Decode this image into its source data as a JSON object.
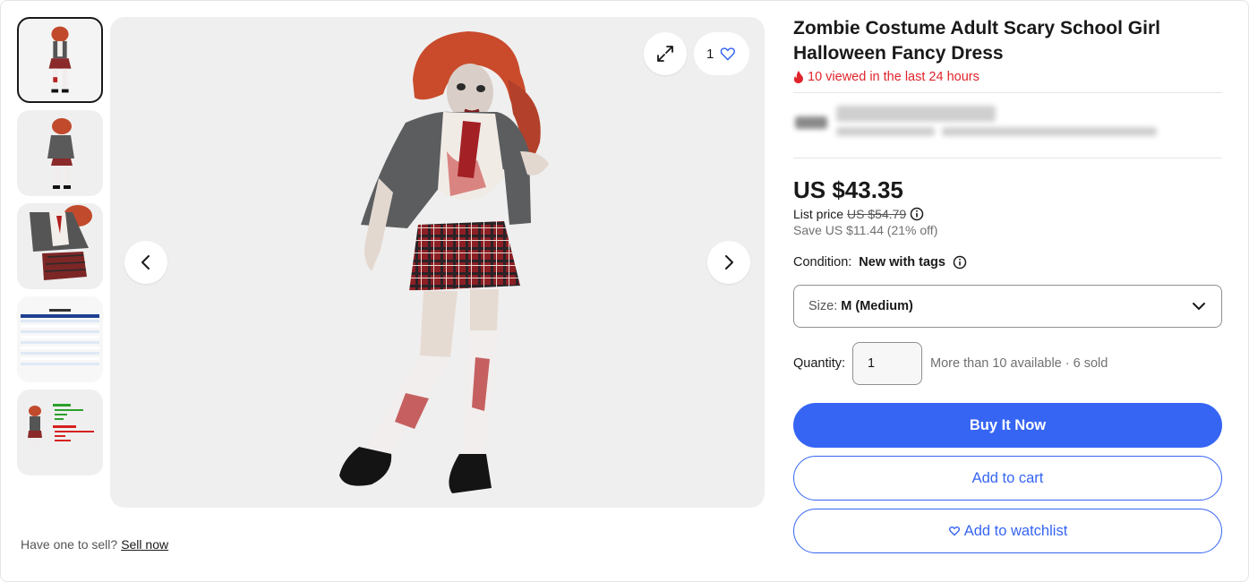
{
  "listing": {
    "title": "Zombie Costume Adult Scary School Girl Halloween Fancy Dress",
    "viewed_text": "10 viewed in the last 24 hours",
    "price": "US $43.35",
    "list_price_label": "List price",
    "list_price_value": "US $54.79",
    "savings": "Save US $11.44 (21% off)",
    "condition_label": "Condition:",
    "condition_value": "New with tags",
    "size_label": "Size:",
    "size_value": "M (Medium)",
    "quantity_label": "Quantity:",
    "quantity_value": "1",
    "availability": "More than 10 available · 6 sold"
  },
  "gallery": {
    "watch_count": "1",
    "thumbnail_count": 5,
    "active_thumbnail": 1
  },
  "buttons": {
    "buy_now": "Buy It Now",
    "add_to_cart": "Add to cart",
    "add_to_watchlist": "Add to watchlist"
  },
  "footer": {
    "sell_prompt": "Have one to sell?",
    "sell_link": "Sell now"
  },
  "colors": {
    "accent": "#3665f3",
    "alert": "#e0242b",
    "text": "#191919"
  },
  "icons": [
    "expand-icon",
    "heart-icon",
    "chevron-left-icon",
    "chevron-right-icon",
    "fire-icon",
    "info-icon",
    "chevron-down-icon"
  ]
}
